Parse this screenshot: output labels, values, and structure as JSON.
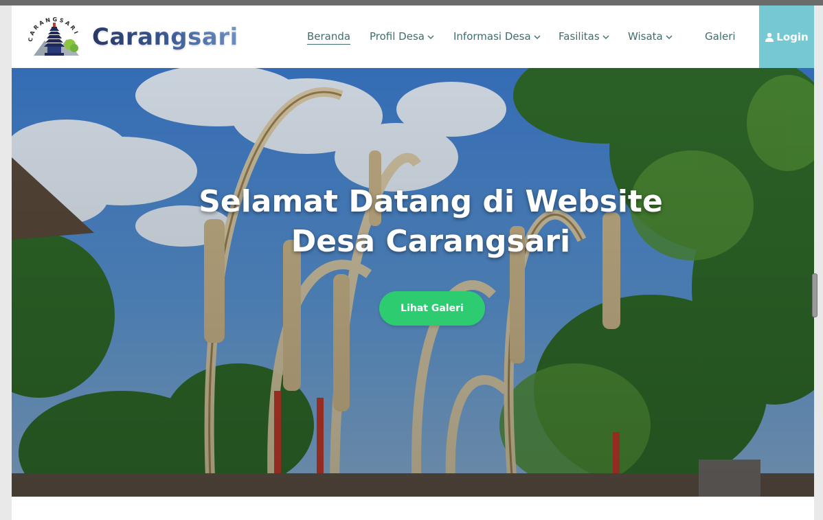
{
  "navbar": {
    "logo_ring_text": "CARANGSARI",
    "brand": "Carangsari",
    "items": [
      {
        "label": "Beranda",
        "active": true,
        "dropdown": false
      },
      {
        "label": "Profil Desa",
        "active": false,
        "dropdown": true
      },
      {
        "label": "Informasi Desa",
        "active": false,
        "dropdown": true
      },
      {
        "label": "Fasilitas",
        "active": false,
        "dropdown": true
      },
      {
        "label": "Wisata",
        "active": false,
        "dropdown": true
      },
      {
        "label": "Galeri",
        "active": false,
        "dropdown": false
      }
    ],
    "login_label": "Login",
    "login_icon": "user-icon"
  },
  "hero": {
    "title_line1": "Selamat Datang di Website",
    "title_line2": "Desa Carangsari",
    "button_label": "Lihat Galeri"
  },
  "colors": {
    "nav_text": "#3f6d6d",
    "login_bg": "#76c8d2",
    "hero_button": "#2ecc71",
    "brand_gradient_start": "#2f3f6f",
    "brand_gradient_end": "#7aa3d8"
  }
}
